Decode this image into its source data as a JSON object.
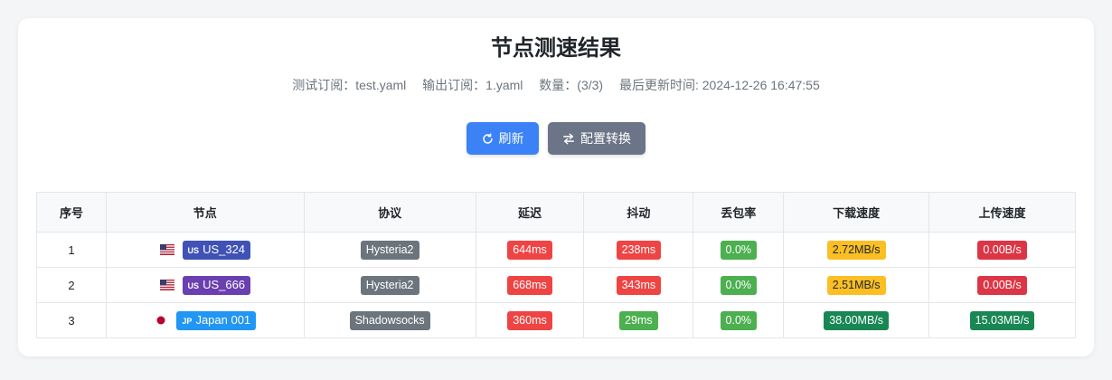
{
  "page": {
    "title": "节点测速结果",
    "meta": {
      "test_sub": "测试订阅：test.yaml",
      "output_sub": "输出订阅：1.yaml",
      "count": "数量：(3/3)",
      "updated": "最后更新时间: 2024-12-26 16:47:55"
    },
    "buttons": {
      "refresh": "刷新",
      "convert": "配置转换"
    }
  },
  "table": {
    "headers": [
      "序号",
      "节点",
      "协议",
      "延迟",
      "抖动",
      "丢包率",
      "下载速度",
      "上传速度"
    ],
    "rows": [
      {
        "index": "1",
        "flag_icon": "us-flag-icon",
        "country_code": "US",
        "node": "US_324",
        "node_color": "#4052b5",
        "protocol": "Hysteria2",
        "latency": "644ms",
        "latency_color": "#ef4444",
        "jitter": "238ms",
        "jitter_color": "#ef4444",
        "loss": "0.0%",
        "loss_color": "#4caf50",
        "download": "2.72MB/s",
        "download_color": "#fbbf24",
        "upload": "0.00B/s",
        "upload_color": "#dc3545"
      },
      {
        "index": "2",
        "flag_icon": "us-flag-icon",
        "country_code": "US",
        "node": "US_666",
        "node_color": "#6a3fb0",
        "protocol": "Hysteria2",
        "latency": "668ms",
        "latency_color": "#ef4444",
        "jitter": "343ms",
        "jitter_color": "#ef4444",
        "loss": "0.0%",
        "loss_color": "#4caf50",
        "download": "2.51MB/s",
        "download_color": "#fbbf24",
        "upload": "0.00B/s",
        "upload_color": "#dc3545"
      },
      {
        "index": "3",
        "flag_icon": "jp-flag-icon",
        "country_code": "JP",
        "node": "Japan 001",
        "node_color": "#2196f3",
        "protocol": "Shadowsocks",
        "latency": "360ms",
        "latency_color": "#ef4444",
        "jitter": "29ms",
        "jitter_color": "#4caf50",
        "loss": "0.0%",
        "loss_color": "#4caf50",
        "download": "38.00MB/s",
        "download_color": "#198754",
        "upload": "15.03MB/s",
        "upload_color": "#198754"
      }
    ],
    "protocol_color": "#6c757d"
  }
}
